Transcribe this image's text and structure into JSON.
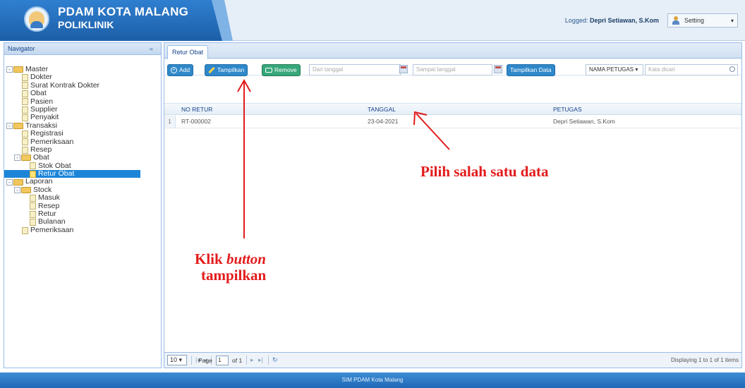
{
  "header": {
    "app_title": "PDAM KOTA MALANG",
    "app_subtitle": "POLIKLINIK",
    "logged_prefix": "Logged: ",
    "logged_user": "Depri Setiawan, S.Kom",
    "setting_label": "Setting"
  },
  "navigator": {
    "title": "Navigator",
    "tree": [
      {
        "label": "Master",
        "type": "folder",
        "toggle": "-"
      },
      {
        "label": "Dokter",
        "type": "file"
      },
      {
        "label": "Surat Kontrak Dokter",
        "type": "file"
      },
      {
        "label": "Obat",
        "type": "file"
      },
      {
        "label": "Pasien",
        "type": "file"
      },
      {
        "label": "Supplier",
        "type": "file"
      },
      {
        "label": "Penyakit",
        "type": "file"
      },
      {
        "label": "Transaksi",
        "type": "folder",
        "toggle": "-"
      },
      {
        "label": "Registrasi",
        "type": "file"
      },
      {
        "label": "Pemeriksaan",
        "type": "file"
      },
      {
        "label": "Resep",
        "type": "file"
      },
      {
        "label": "Obat",
        "type": "folder",
        "toggle": "-"
      },
      {
        "label": "Stok Obat",
        "type": "file"
      },
      {
        "label": "Retur Obat",
        "type": "file",
        "selected": true
      },
      {
        "label": "Laporan",
        "type": "folder",
        "toggle": "-"
      },
      {
        "label": "Stock",
        "type": "folder",
        "toggle": "-"
      },
      {
        "label": "Masuk",
        "type": "file"
      },
      {
        "label": "Resep",
        "type": "file"
      },
      {
        "label": "Retur",
        "type": "file"
      },
      {
        "label": "Bulanan",
        "type": "file"
      },
      {
        "label": "Pemeriksaan",
        "type": "file"
      }
    ]
  },
  "main": {
    "tab_label": "Retur Obat",
    "toolbar": {
      "add_label": "Add",
      "tampilkan_label": "Tampilkan",
      "remove_label": "Remove",
      "date_from_placeholder": "Dari tanggal",
      "date_to_placeholder": "Sampai tanggal",
      "tampilkan_data_label": "Tampilkan Data",
      "filter_select": "NAMA PETUGAS",
      "search_placeholder": "Kata dicari"
    },
    "grid": {
      "columns": [
        "NO RETUR",
        "TANGGAL",
        "PETUGAS"
      ],
      "rows": [
        {
          "num": "1",
          "no_retur": "RT-000002",
          "tanggal": "23-04-2021",
          "petugas": "Depri Setiawan, S.Kom"
        }
      ]
    },
    "pager": {
      "page_size": "10",
      "page_label": "Page",
      "page_value": "1",
      "of_label": "of 1",
      "display_text": "Displaying 1 to 1 of 1 items"
    }
  },
  "footer": {
    "text": "SIM PDAM Kota Malang"
  },
  "annotations": {
    "pilih": "Pilih salah satu data",
    "klik_prefix": "Klik ",
    "klik_italic": "button",
    "klik_line2": "tampilkan",
    "color": "#e31b1b"
  }
}
